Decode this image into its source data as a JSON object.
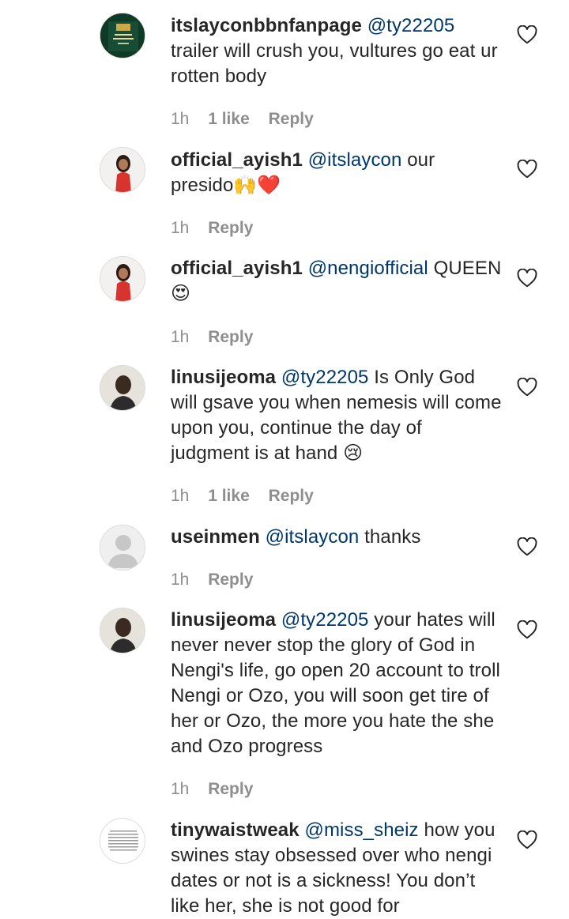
{
  "comments": [
    {
      "username": "itslayconbbnfanpage",
      "mention": "@ty22205",
      "text": "trailer will crush you, vultures go eat ur rotten body",
      "time": "1h",
      "likes": "1 like",
      "reply": "Reply",
      "avatar": "green-poster-avatar"
    },
    {
      "username": "official_ayish1",
      "mention": "@itslaycon",
      "text": "our presido🙌❤️",
      "time": "1h",
      "reply": "Reply",
      "avatar": "woman-red-dress-avatar"
    },
    {
      "username": "official_ayish1",
      "mention": "@nengiofficial",
      "text": "QUEEN😍",
      "time": "1h",
      "reply": "Reply",
      "avatar": "woman-red-dress-avatar"
    },
    {
      "username": "linusijeoma",
      "mention": "@ty22205",
      "text": "Is Only God will gsave you when nemesis will come upon you, continue the day of judgment is at hand 😢",
      "time": "1h",
      "likes": "1 like",
      "reply": "Reply",
      "avatar": "woman-portrait-avatar"
    },
    {
      "username": "useinmen",
      "mention": "@itslaycon",
      "text": "thanks",
      "time": "1h",
      "reply": "Reply",
      "avatar": "default-user-avatar"
    },
    {
      "username": "linusijeoma",
      "mention": "@ty22205",
      "text": "your hates will never never stop the glory of God in Nengi's life, go open 20 account to troll Nengi or Ozo, you will soon get tire of her or Ozo, the more you hate the she and Ozo progress",
      "time": "1h",
      "reply": "Reply",
      "avatar": "woman-portrait-avatar"
    },
    {
      "username": "tinywaistweak",
      "mention": "@miss_sheiz",
      "text": "how you swines stay obsessed over who nengi dates or not is a sickness! You don’t like her, she is not good for",
      "avatar": "text-note-avatar"
    }
  ]
}
